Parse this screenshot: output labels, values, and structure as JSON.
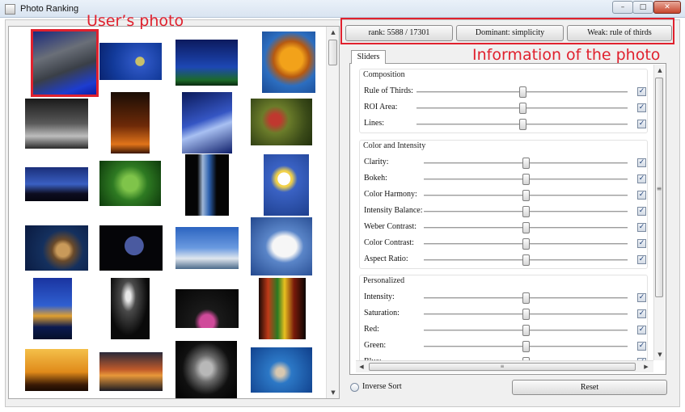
{
  "window": {
    "title": "Photo Ranking",
    "minimize": "–",
    "maximize": "□",
    "close": "✕"
  },
  "annotations": {
    "users_photo": "User’s photo",
    "photo_info": "Information of the photo"
  },
  "info_buttons": {
    "rank": "rank: 5588 / 17301",
    "dominant": "Dominant: simplicity",
    "weak": "Weak: rule of thirds"
  },
  "tab": {
    "label": "Sliders"
  },
  "groups": [
    {
      "title": "Composition",
      "sliders": [
        {
          "label": "Rule of Thirds:",
          "level": 0.5,
          "checked": true
        },
        {
          "label": "ROI Area:",
          "level": 0.5,
          "checked": true
        },
        {
          "label": "Lines:",
          "level": 0.5,
          "checked": true
        }
      ]
    },
    {
      "title": "Color and Intensity",
      "sliders": [
        {
          "label": "Clarity:",
          "level": 0.5,
          "checked": true
        },
        {
          "label": "Bokeh:",
          "level": 0.5,
          "checked": true
        },
        {
          "label": "Color Harmony:",
          "level": 0.5,
          "checked": true
        },
        {
          "label": "Intensity Balance:",
          "level": 0.5,
          "checked": true
        },
        {
          "label": "Weber Contrast:",
          "level": 0.5,
          "checked": true
        },
        {
          "label": "Color Contrast:",
          "level": 0.5,
          "checked": true
        },
        {
          "label": "Aspect Ratio:",
          "level": 0.5,
          "checked": true
        }
      ]
    },
    {
      "title": "Personalized",
      "sliders": [
        {
          "label": "Intensity:",
          "level": 0.5,
          "checked": true
        },
        {
          "label": "Saturation:",
          "level": 0.5,
          "checked": true
        },
        {
          "label": "Red:",
          "level": 0.5,
          "checked": true
        },
        {
          "label": "Green:",
          "level": 0.5,
          "checked": true
        },
        {
          "label": "Blue:",
          "level": 0.5,
          "checked": true
        }
      ]
    }
  ],
  "scroll_glyph": "≡",
  "bottom": {
    "inverse_sort": "Inverse Sort",
    "reset": "Reset"
  },
  "colors": {
    "highlight": "#e0212e"
  },
  "photos": [
    {
      "name": "robot-statue",
      "bg": "linear-gradient(160deg,#1b2a7c 0%,#6a6f78 35%,#3a3f47 60%,#1d3dd0 85%,#0d1da8 100%)",
      "selected": true
    },
    {
      "name": "blue-glass",
      "bg": "radial-gradient(circle at 65% 50%,#c8c06a 0 10%,#2f58c6 11%,#123a9a 60%,#0a2470 100%)"
    },
    {
      "name": "night-sky",
      "bg": "linear-gradient(#0c1a5e 0%,#1d47b4 60%,#1c6a2a 88%,#0a2a10 100%)"
    },
    {
      "name": "autumn-leaf",
      "bg": "radial-gradient(circle at 55% 45%,#f2a21a 0 25%,#b65a12 40%,#2c6ec0 60%,#1a4a94 100%)"
    },
    {
      "name": "light-beams",
      "bg": "linear-gradient(#1a1a1a 0%,#5a5a5a 50%,#bdbdbd 75%,#2a2a2a 100%)"
    },
    {
      "name": "fire-glow",
      "bg": "linear-gradient(#1a0d05 0%,#6e2a08 55%,#e0741a 85%,#3a1505 100%)"
    },
    {
      "name": "blue-neon-glass",
      "bg": "linear-gradient(160deg,#0b1a5a 0%,#3556c4 45%,#a8c0f2 60%,#0e1e6a 100%)"
    },
    {
      "name": "hummingbird",
      "bg": "radial-gradient(circle at 40% 45%,#c0382f 0 12%,#6b7c2a 30%,#3a4a18 70%,#22300c 100%)"
    },
    {
      "name": "palm-sunset",
      "bg": "linear-gradient(#1a2f7a 0%,#3a5fc2 50%,#0d0d20 78%,#050510 100%)"
    },
    {
      "name": "fern",
      "bg": "radial-gradient(circle at 50% 50%,#7fc44a 0 20%,#2e7a22 45%,#0e3a0c 100%)"
    },
    {
      "name": "water-bottle",
      "bg": "linear-gradient(90deg,#050505 0%,#050505 28%,#9fb7d8 40%,#2a5fae 55%,#050505 72%,#050505 100%)"
    },
    {
      "name": "daisy",
      "bg": "radial-gradient(circle at 45% 40%,#ffffff 0 14%,#f2d24a 15% 18%,#3a62c4 30%,#1e3f8e 100%)"
    },
    {
      "name": "spoon-seeds",
      "bg": "radial-gradient(circle at 60% 55%,#c99a5a 0 14%,#6a4a2a 24%,#14305e 45%,#0a1a40 100%)"
    },
    {
      "name": "crescent-moon",
      "bg": "radial-gradient(circle at 55% 45%,#4a5aa0 0 22%,#050508 23% 100%)"
    },
    {
      "name": "wind-turbines",
      "bg": "linear-gradient(#2c64c0 0%,#6a9ae0 50%,#dfe6ee 75%,#4a6a8a 100%)"
    },
    {
      "name": "seagull",
      "bg": "radial-gradient(ellipse at 55% 50%,#f6f6f6 0 25%,#5a85c8 40%,#23488e 100%)"
    },
    {
      "name": "opera-house",
      "bg": "linear-gradient(#1a34a0 0%,#2f5fd0 45%,#e0a030 62%,#0b1a50 80%,#05102a 100%)"
    },
    {
      "name": "ice-skater",
      "bg": "radial-gradient(ellipse at 45% 30%,#e8e8e8 0 8%,#4a4a4a 25%,#0a0a0a 65%)"
    },
    {
      "name": "pink-lotus",
      "bg": "radial-gradient(ellipse at 50% 85%,#d04a9a 0 16%,#1a1a1a 28%,#050505 100%)"
    },
    {
      "name": "stained-glass",
      "bg": "linear-gradient(90deg,#1a0a05 0%,#c03a18 20%,#2a7a22 40%,#e8c020 55%,#7a1a0a 75%,#0a0503 100%)"
    },
    {
      "name": "tree-sunset",
      "bg": "linear-gradient(#f4c04a 0%,#e08a1a 55%,#3a1a05 85%,#1a0a02 100%)"
    },
    {
      "name": "dusk-landscape",
      "bg": "linear-gradient(#2a2a3a 0%,#c05a2a 45%,#e8983a 60%,#1a1a22 100%)"
    },
    {
      "name": "face-portrait",
      "bg": "radial-gradient(ellipse at 50% 45%,#b8b8b8 0 14%,#6a6a6a 28%,#101010 55%,#000 100%)"
    },
    {
      "name": "underwater-shell",
      "bg": "radial-gradient(circle at 48% 55%,#d8c8b0 0 10%,#2c78c6 28%,#0f3e8a 100%)"
    }
  ]
}
